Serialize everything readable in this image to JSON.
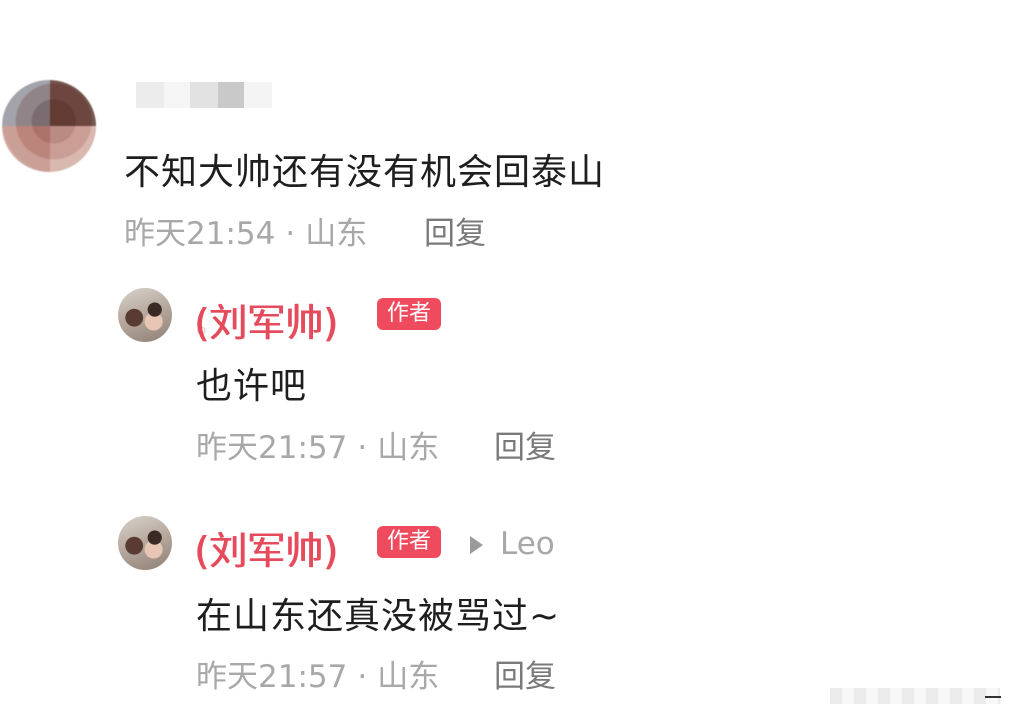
{
  "comment": {
    "text": "不知大帅还有没有机会回泰山",
    "time": "昨天21:54",
    "location": "山东",
    "reply_label": "回复"
  },
  "replies": [
    {
      "author": "(刘军帅)",
      "badge": "作者",
      "text": "也许吧",
      "time": "昨天21:57",
      "location": "山东",
      "reply_label": "回复"
    },
    {
      "author": "(刘军帅)",
      "badge": "作者",
      "reply_to": "Leo",
      "text": "在山东还真没被骂过~",
      "time": "昨天21:57",
      "location": "山东",
      "reply_label": "回复"
    }
  ],
  "separator": "·",
  "colors": {
    "accent": "#ef4b5e",
    "author_name": "#e64b5c",
    "meta": "#a8a8a8"
  }
}
